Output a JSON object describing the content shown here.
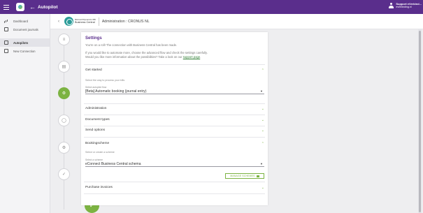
{
  "topbar": {
    "title": "Autopilot",
    "user_name": "Support eVerbind...",
    "user_email": "everbinding.nl"
  },
  "sidebar": {
    "items": [
      {
        "label": "Dashboard",
        "icon": "chart-icon"
      },
      {
        "label": "Document journals",
        "icon": "document-journal-icon"
      },
      {
        "label": "Autopilots",
        "icon": "autopilot-icon"
      },
      {
        "label": "New Connection",
        "icon": "add-connection-icon"
      }
    ]
  },
  "header": {
    "logo_line1": "Microsoft Dynamics 365",
    "logo_line2": "Business Central",
    "title": "Administration : CRONUS NL"
  },
  "card": {
    "title": "Settings",
    "intro1": "You're on a roll! The connection with Business Central has been made.",
    "intro2": "If you would like to automate more, choose the advanced flow and check the settings carefully.",
    "intro3": "Would you like more information about the possibilities? Take a look on our",
    "intro_link": "support page",
    "intro_end": ".",
    "sections": {
      "get_started": "Get started",
      "get_started_hint": "Select the way to process your bills",
      "flow_label": "Select autopilot flow",
      "flow_value": "[Beta] Automatic booking (journal entry)",
      "administration": "Administration",
      "document_types": "Document types",
      "send_options": "Send options",
      "bookingscheme": "Bookingscheme",
      "bookingscheme_hint": "Select or create a scheme",
      "scheme_label": "Select a scheme",
      "scheme_value": "eConnect Business Central schema",
      "manage_button": "MANAGE SCHEMES",
      "purchase_invoices": "Purchase invoices"
    }
  },
  "colors": {
    "brand": "#5a2e8c",
    "accent": "#7cb342"
  }
}
